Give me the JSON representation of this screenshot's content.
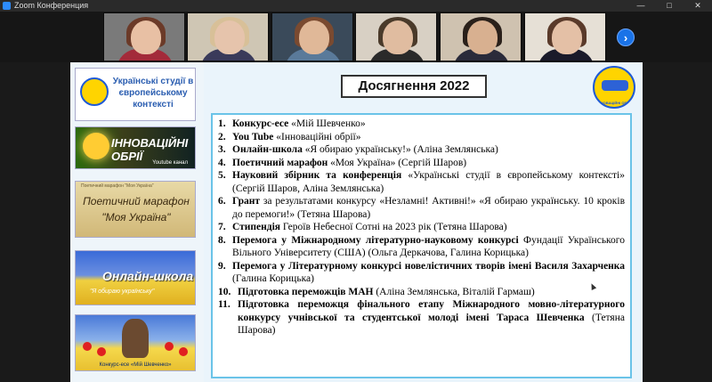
{
  "window": {
    "title": "Zoom Конференция",
    "controls": [
      "—",
      "□",
      "✕"
    ]
  },
  "participants": [
    {
      "name": "participant-1",
      "bg": "#7a7a7a",
      "hair": "#6b3a28",
      "skin": "#e8c0a4",
      "shirt": "#a32a3a"
    },
    {
      "name": "participant-2",
      "bg": "#cfc6b4",
      "hair": "#d8c098",
      "skin": "#e6c4ac",
      "shirt": "#3a3a5a"
    },
    {
      "name": "participant-3",
      "bg": "#3a4a5a",
      "hair": "#7a4a30",
      "skin": "#e0b898",
      "shirt": "#5a7a9a"
    },
    {
      "name": "participant-4",
      "bg": "#d8d0c4",
      "hair": "#4a3a2a",
      "skin": "#e0bca0",
      "shirt": "#2a2a2a"
    },
    {
      "name": "participant-5",
      "bg": "#cfc2b0",
      "hair": "#2a201a",
      "skin": "#d8b090",
      "shirt": "#2a2a3a"
    },
    {
      "name": "participant-6",
      "bg": "#e6e0d6",
      "hair": "#5a3a2a",
      "skin": "#e4c0a6",
      "shirt": "#1a1a2a"
    },
    {
      "name": "participant-7",
      "bg": "#f0e8de",
      "hair": "#4a2a1a",
      "skin": "#e6c4aa",
      "shirt": "#404050"
    }
  ],
  "next_button": "›",
  "slide": {
    "title": "Досягнення 2022",
    "thumbs": {
      "t1": "Українські студії в європейському контексті",
      "t2": "ІННОВАЦІЙНІ ОБРІЇ",
      "t2_sub": "Youtube канал",
      "t3_top": "Поетичний марафон \"Моя Україна\"",
      "t3": "Поетичний марафон \"Моя Україна\"",
      "t4": "Онлайн-школа",
      "t4_sub": "\"Я обираю українську\"",
      "t5": "Конкурс-есе «Мій Шевченко»"
    },
    "emblem_text": "ІННОВАЦІЙНІ ОБРІЇ",
    "items": [
      {
        "n": "1.",
        "b": "Конкурс-есе",
        "t": " «Мій Шевченко»"
      },
      {
        "n": "2.",
        "b": "You Tube",
        "t": " «Інноваційні обрії»"
      },
      {
        "n": "3.",
        "b": "Онлайн-школа",
        "t": " «Я обираю українську!» (Аліна Землянська)"
      },
      {
        "n": "4.",
        "b": "Поетичний марафон",
        "t": " «Моя Україна» (Сергій Шаров)"
      },
      {
        "n": "5.",
        "b": "Науковий збірник та конференція",
        "t": " «Українські студії в європейському контексті» (Сергій Шаров, Аліна Землянська)"
      },
      {
        "n": "6.",
        "b": "Грант",
        "t": " за результатами конкурсу «Незламні! Активні!» «Я обираю українську. 10 кроків до перемоги!» (Тетяна Шарова)"
      },
      {
        "n": "7.",
        "b": "Стипендія",
        "t": " Героїв Небесної Сотні на 2023 рік (Тетяна Шарова)"
      },
      {
        "n": "8.",
        "b": "Перемога у Міжнародному літературно-науковому конкурсі",
        "t": " Фундації Українського Вільного Університету (США) (Ольга Деркачова, Галина Корицька)"
      },
      {
        "n": "9.",
        "b": "Перемога у Літературному конкурсі новелістичних творів імені Василя Захарченка",
        "t": " (Галина Корицька)"
      },
      {
        "n": "10.",
        "b": "Підготовка переможців МАН",
        "t": " (Аліна Землянська, Віталій Гармаш)"
      },
      {
        "n": "11.",
        "b": "Підготовка переможця фінального етапу Міжнародного мовно-літературного конкурсу учнівської та студентської молоді імені Тараса Шевченка",
        "t": " (Тетяна Шарова)"
      }
    ]
  }
}
